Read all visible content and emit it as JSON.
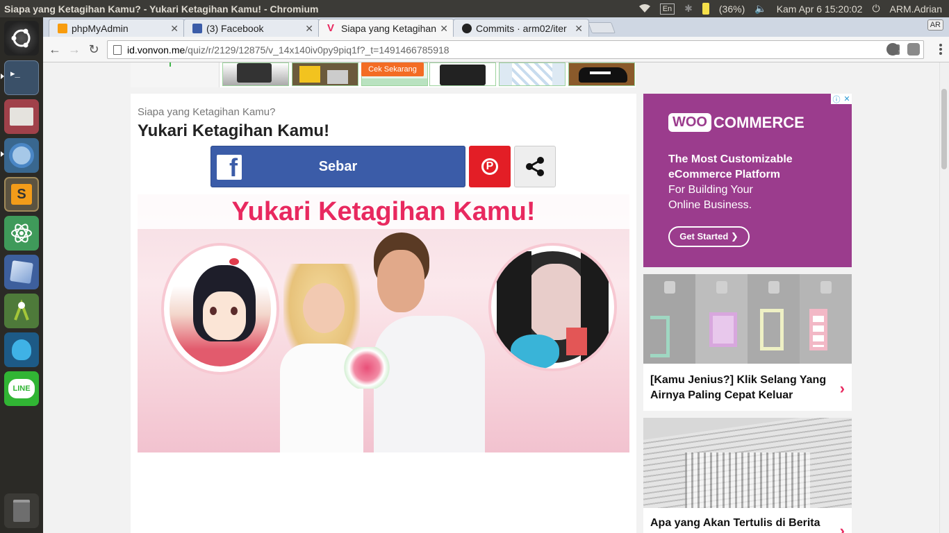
{
  "os": {
    "window_title": "Siapa yang Ketagihan Kamu? - Yukari Ketagihan Kamu! - Chromium",
    "keyboard": "En",
    "battery": "(36%)",
    "datetime": "Kam Apr  6 15:20:02",
    "user": "ARM.Adrian"
  },
  "launcher": {
    "items": [
      "ubuntu-dash",
      "terminal",
      "files",
      "chromium",
      "sublime-text",
      "atom",
      "virtualbox",
      "android-studio",
      "mysql-workbench",
      "line",
      "trash"
    ]
  },
  "browser": {
    "tabs": [
      {
        "label": "phpMyAdmin",
        "favicon": "phpmyadmin-icon"
      },
      {
        "label": "(3) Facebook",
        "favicon": "facebook-icon"
      },
      {
        "label": "Siapa yang Ketagihan",
        "favicon": "vonvon-icon"
      },
      {
        "label": "Commits · arm02/iter",
        "favicon": "github-icon"
      }
    ],
    "badge": "AR",
    "url_host": "id.vonvon.me",
    "url_path": "/quiz/r/2129/12875/v_14x140iv0py9piq1f?_t=1491466785918"
  },
  "page": {
    "ad_strip": {
      "cta": "Cek Sekarang"
    },
    "quiz_subtitle": "Siapa yang Ketagihan Kamu?",
    "quiz_title": "Yukari Ketagihan Kamu!",
    "share_facebook": "Sebar",
    "result_banner": "Yukari Ketagihan Kamu!"
  },
  "sidebar": {
    "woo": {
      "brand_woo": "WOO",
      "brand_commerce": "COMMERCE",
      "headline_1": "The Most Customizable",
      "headline_2": "eCommerce Platform",
      "sub_1": "For Building Your",
      "sub_2": "Online Business.",
      "cta": "Get Started ❯"
    },
    "cards": [
      {
        "title": "[Kamu Jenius?] Klik Selang Yang Airnya Paling Cepat Keluar"
      },
      {
        "title": "Apa yang Akan Tertulis di Berita"
      }
    ]
  },
  "colors": {
    "fb_blue": "#3b5ca8",
    "pinterest_red": "#e31e26",
    "banner_pink": "#e8295f",
    "woo_purple": "#9b3c8d"
  }
}
